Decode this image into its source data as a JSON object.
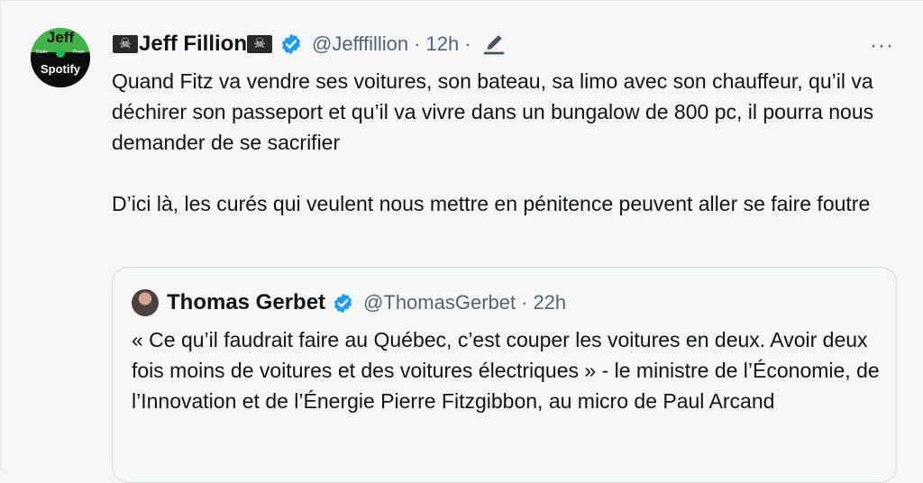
{
  "tweet": {
    "avatar": {
      "top": "Jeff",
      "left_small": "Radio",
      "right_small": "Pirate",
      "bottom": "Spotify"
    },
    "name": "Jeff Fillion",
    "handle": "@Jefffillion",
    "time": "12h",
    "more": "···",
    "paragraphs": [
      "Quand Fitz va vendre ses voitures, son bateau, sa limo avec son chauffeur, qu’il va déchirer son passeport et qu’il va vivre dans un bungalow de 800 pc, il pourra nous demander de se sacrifier",
      "D’ici là, les curés qui veulent nous mettre en pénitence peuvent aller se faire foutre"
    ]
  },
  "quote": {
    "name": "Thomas Gerbet",
    "handle": "@ThomasGerbet",
    "time": "22h",
    "text": "« Ce qu’il faudrait faire au Québec, c’est couper les voitures en deux. Avoir deux fois moins de voitures et des voitures électriques » - le ministre de l’Économie, de l’Innovation et de l’Énergie Pierre Fitzgibbon, au micro de Paul Arcand"
  },
  "colors": {
    "verified": "#1d9bf0",
    "secondary": "#536471",
    "text": "#0f1419",
    "background": "#f7f7f7"
  },
  "icons": [
    "pirate-flag-icon",
    "verified-badge-icon",
    "edit-pencil-icon",
    "more-icon"
  ]
}
